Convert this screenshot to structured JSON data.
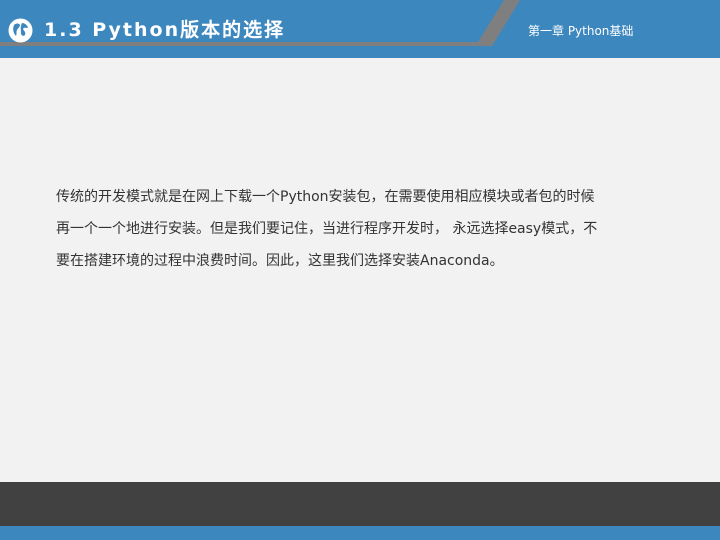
{
  "header": {
    "title": "1.3 Python版本的选择",
    "chapter": "第一章 Python基础",
    "icon": "globe-icon"
  },
  "content": {
    "lines": [
      "传统的开发模式就是在网上下载一个Python安装包，在需要使用相应模块或者包的时候",
      "再一个一个地进行安装。但是我们要记住，当进行程序开发时， 永远选择easy模式，不",
      "要在搭建环境的过程中浪费时间。因此，这里我们选择安装Anaconda。"
    ]
  },
  "colors": {
    "header_blue": "#3d87bf",
    "header_gray": "#7f7f7f",
    "background": "#f2f2f2",
    "footer_dark": "#414141"
  }
}
